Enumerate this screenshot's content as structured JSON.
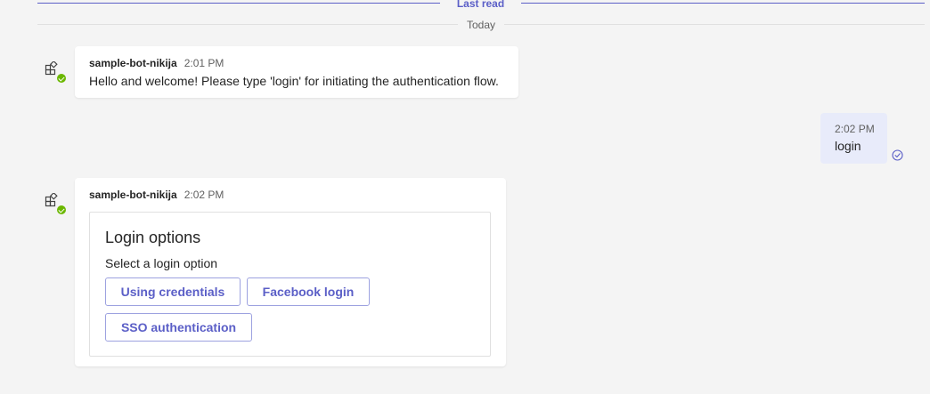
{
  "dividers": {
    "last_read": "Last read",
    "today": "Today"
  },
  "messages": [
    {
      "sender": "sample-bot-nikija",
      "time": "2:01 PM",
      "text": "Hello and welcome! Please type 'login' for initiating the authentication flow."
    },
    {
      "sender": "sample-bot-nikija",
      "time": "2:02 PM",
      "card": {
        "title": "Login options",
        "text": "Select a login option",
        "buttons": [
          "Using credentials",
          "Facebook login",
          "SSO authentication"
        ]
      }
    }
  ],
  "my_message": {
    "time": "2:02 PM",
    "text": "login",
    "status_icon": "read-receipt-icon"
  },
  "avatar": {
    "icon": "bot-apps-icon",
    "presence": "available"
  },
  "colors": {
    "accent": "#5b5fc7",
    "background": "#f4f4f4",
    "my_bubble": "#e8ebfa",
    "presence_available": "#6bb700"
  }
}
